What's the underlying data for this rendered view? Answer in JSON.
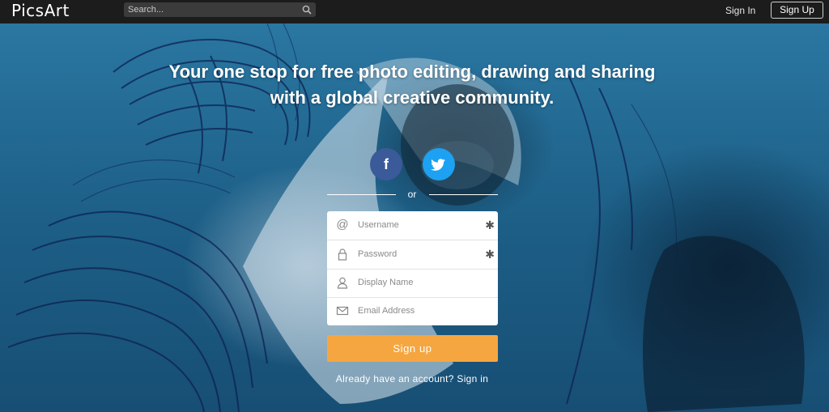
{
  "brand": {
    "logo_text": "PicsArt"
  },
  "search": {
    "placeholder": "Search...",
    "icon": "search-icon"
  },
  "nav": {
    "sign_in": "Sign In",
    "sign_up": "Sign Up"
  },
  "hero": {
    "headline_line1": "Your one stop for free photo editing, drawing and sharing",
    "headline_line2": "with a global creative community."
  },
  "social": {
    "facebook": {
      "icon": "facebook-icon",
      "glyph": "f",
      "color": "#3b5a99"
    },
    "twitter": {
      "icon": "twitter-icon",
      "color": "#1da1f2"
    }
  },
  "divider": {
    "or_text": "or"
  },
  "form": {
    "username_placeholder": "Username",
    "password_placeholder": "Password",
    "display_name_placeholder": "Display Name",
    "email_placeholder": "Email Address",
    "required_mark": "✱",
    "at_glyph": "@"
  },
  "signup_button": {
    "label": "Sign up",
    "color": "#f6a640"
  },
  "footer": {
    "already_text": "Already have an account?",
    "signin_link": "Sign in"
  }
}
